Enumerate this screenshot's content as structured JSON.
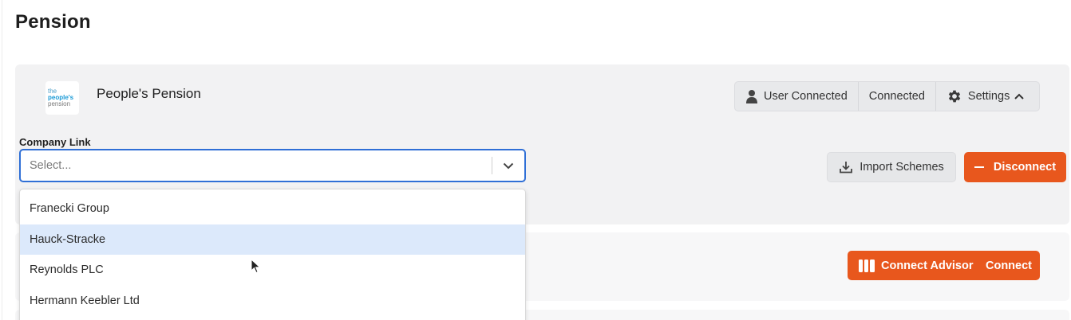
{
  "page": {
    "title": "Pension"
  },
  "provider": {
    "name": "People's Pension",
    "logo_lines": [
      "the",
      "people's",
      "pension"
    ]
  },
  "status": {
    "user": "User Connected",
    "connection": "Connected",
    "settings": "Settings"
  },
  "company_link": {
    "label": "Company Link",
    "placeholder": "Select...",
    "options": [
      "Franecki Group",
      "Hauck-Stracke",
      "Reynolds PLC",
      "Hermann Keebler Ltd"
    ],
    "highlighted_option": "Hauck-Stracke"
  },
  "actions": {
    "import_label": "Import Schemes",
    "disconnect_label": "Disconnect"
  },
  "advisor": {
    "label": "Connect Advisor",
    "connect_label": "Connect"
  },
  "colors": {
    "accent": "#e8571d",
    "focus": "#2f6fd6",
    "option_hover": "#dce9fb"
  }
}
